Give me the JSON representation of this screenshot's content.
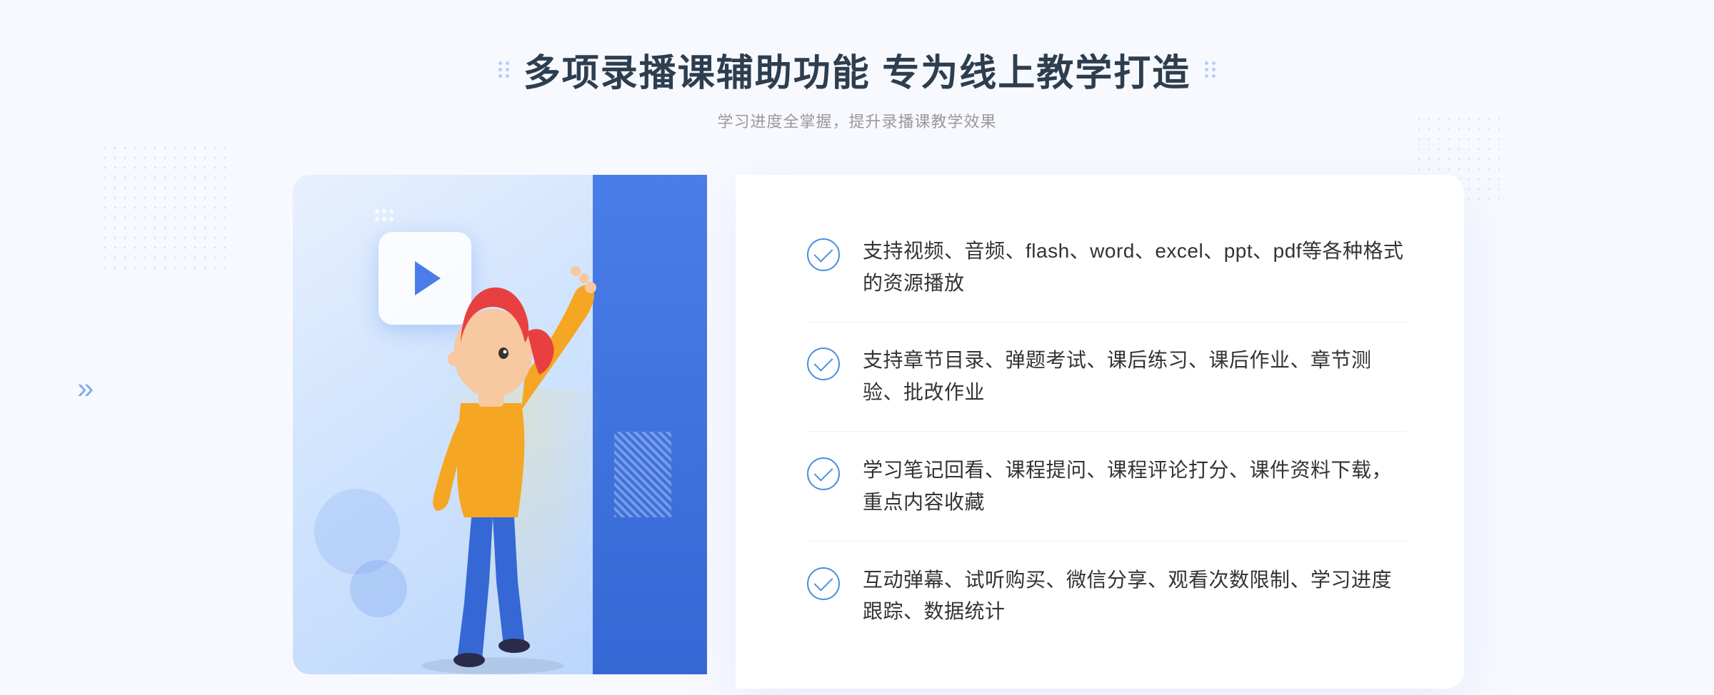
{
  "header": {
    "title": "多项录播课辅助功能 专为线上教学打造",
    "subtitle": "学习进度全掌握，提升录播课教学效果",
    "deco_left": "grid-dots-icon",
    "deco_right": "grid-dots-icon"
  },
  "features": [
    {
      "id": 1,
      "text": "支持视频、音频、flash、word、excel、ppt、pdf等各种格式的资源播放"
    },
    {
      "id": 2,
      "text": "支持章节目录、弹题考试、课后练习、课后作业、章节测验、批改作业"
    },
    {
      "id": 3,
      "text": "学习笔记回看、课程提问、课程评论打分、课件资料下载，重点内容收藏"
    },
    {
      "id": 4,
      "text": "互动弹幕、试听购买、微信分享、观看次数限制、学习进度跟踪、数据统计"
    }
  ],
  "colors": {
    "primary": "#4a7de8",
    "text_dark": "#2c3e50",
    "text_medium": "#333333",
    "text_light": "#999999",
    "bg_card": "#ffffff",
    "bg_page": "#f8f9ff",
    "accent_blue": "#4a90e2"
  },
  "chevron": "»"
}
